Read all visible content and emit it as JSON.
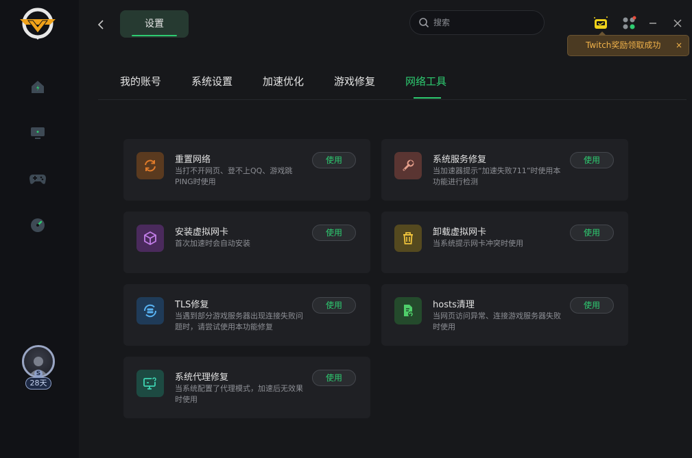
{
  "header": {
    "title_tab": "设置",
    "search_placeholder": "搜索"
  },
  "toast": {
    "text": "Twitch奖励领取成功",
    "close": "×"
  },
  "user": {
    "level_letter": "S",
    "days_badge": "28天"
  },
  "tabs": [
    "我的账号",
    "系统设置",
    "加速优化",
    "游戏修复",
    "网络工具"
  ],
  "active_tab": "网络工具",
  "button_label": "使用",
  "tools": [
    {
      "title": "重置网络",
      "desc": "当打不开网页、登不上QQ、游戏跳PING时使用",
      "icon": "refresh-icon",
      "color": "#e07b2a",
      "bg": "#5a3a1f"
    },
    {
      "title": "系统服务修复",
      "desc": "当加速器提示“加速失败711”时使用本功能进行检测",
      "icon": "wrench-icon",
      "color": "#e7a08c",
      "bg": "#5a3532"
    },
    {
      "title": "安装虚拟网卡",
      "desc": "首次加速时会自动安装",
      "icon": "cube-icon",
      "color": "#c37ee8",
      "bg": "#4a2a5c"
    },
    {
      "title": "卸载虚拟网卡",
      "desc": "当系统提示网卡冲突时使用",
      "icon": "trash-icon",
      "color": "#f0c43c",
      "bg": "#54491f"
    },
    {
      "title": "TLS修复",
      "desc": "当遇到部分游戏服务器出现连接失败问题时，请尝试使用本功能修复",
      "icon": "server-refresh-icon",
      "color": "#58b2f2",
      "bg": "#1f3b58"
    },
    {
      "title": "hosts清理",
      "desc": "当网页访问异常、连接游戏服务器失败时使用",
      "icon": "file-refresh-icon",
      "color": "#4fcf6a",
      "bg": "#244a2c"
    },
    {
      "title": "系统代理修复",
      "desc": "当系统配置了代理模式，加速后无效果时使用",
      "icon": "monitor-refresh-icon",
      "color": "#3fd6b4",
      "bg": "#1d4a42"
    }
  ]
}
